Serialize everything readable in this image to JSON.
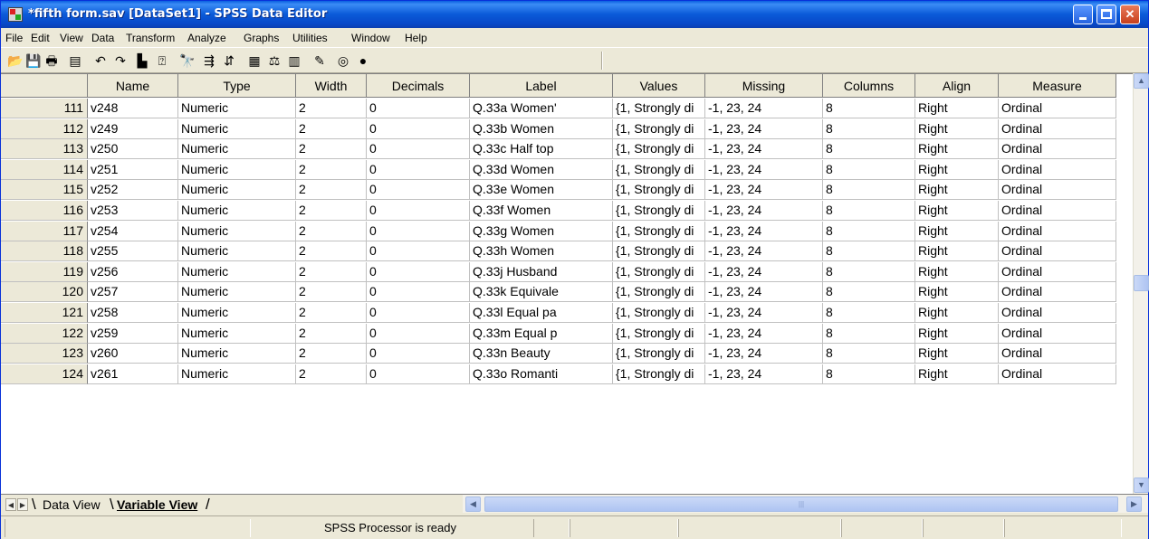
{
  "window": {
    "title": "*fifth form.sav [DataSet1] - SPSS Data Editor",
    "minimize": "",
    "maximize": "",
    "close": "✕"
  },
  "menu": [
    "File",
    "Edit",
    "View",
    "Data",
    "Transform",
    "Analyze",
    "Graphs",
    "Utilities",
    "Window",
    "Help"
  ],
  "toolbar_icons": [
    {
      "name": "open-icon",
      "glyph": "📂"
    },
    {
      "name": "save-icon",
      "glyph": "💾"
    },
    {
      "name": "print-icon",
      "glyph": "🖶"
    },
    {
      "name": "dialog-recall-icon",
      "glyph": "▤"
    },
    {
      "name": "undo-icon",
      "glyph": "↶"
    },
    {
      "name": "redo-icon",
      "glyph": "↷"
    },
    {
      "name": "goto-case-icon",
      "glyph": "▙"
    },
    {
      "name": "variables-icon",
      "glyph": "⍰"
    },
    {
      "name": "find-icon",
      "glyph": "🔭"
    },
    {
      "name": "insert-cases-icon",
      "glyph": "⇶"
    },
    {
      "name": "insert-variable-icon",
      "glyph": "⇵"
    },
    {
      "name": "split-file-icon",
      "glyph": "▦"
    },
    {
      "name": "weight-cases-icon",
      "glyph": "⚖"
    },
    {
      "name": "select-cases-icon",
      "glyph": "▥"
    },
    {
      "name": "value-labels-icon",
      "glyph": "✎"
    },
    {
      "name": "use-sets-icon",
      "glyph": "◎"
    },
    {
      "name": "show-all-icon",
      "glyph": "●"
    }
  ],
  "grid": {
    "columns": [
      "",
      "Name",
      "Type",
      "Width",
      "Decimals",
      "Label",
      "Values",
      "Missing",
      "Columns",
      "Align",
      "Measure"
    ],
    "rows": [
      {
        "num": "111",
        "cells": [
          "v248",
          "Numeric",
          "2",
          "0",
          "Q.33a Women'",
          "{1, Strongly di",
          "-1, 23, 24",
          "8",
          "Right",
          "Ordinal"
        ]
      },
      {
        "num": "112",
        "cells": [
          "v249",
          "Numeric",
          "2",
          "0",
          "Q.33b Women",
          "{1, Strongly di",
          "-1, 23, 24",
          "8",
          "Right",
          "Ordinal"
        ]
      },
      {
        "num": "113",
        "cells": [
          "v250",
          "Numeric",
          "2",
          "0",
          "Q.33c Half top",
          "{1, Strongly di",
          "-1, 23, 24",
          "8",
          "Right",
          "Ordinal"
        ]
      },
      {
        "num": "114",
        "cells": [
          "v251",
          "Numeric",
          "2",
          "0",
          "Q.33d Women",
          "{1, Strongly di",
          "-1, 23, 24",
          "8",
          "Right",
          "Ordinal"
        ]
      },
      {
        "num": "115",
        "cells": [
          "v252",
          "Numeric",
          "2",
          "0",
          "Q.33e Women",
          "{1, Strongly di",
          "-1, 23, 24",
          "8",
          "Right",
          "Ordinal"
        ]
      },
      {
        "num": "116",
        "cells": [
          "v253",
          "Numeric",
          "2",
          "0",
          "Q.33f Women",
          "{1, Strongly di",
          "-1, 23, 24",
          "8",
          "Right",
          "Ordinal"
        ]
      },
      {
        "num": "117",
        "cells": [
          "v254",
          "Numeric",
          "2",
          "0",
          "Q.33g Women",
          "{1, Strongly di",
          "-1, 23, 24",
          "8",
          "Right",
          "Ordinal"
        ]
      },
      {
        "num": "118",
        "cells": [
          "v255",
          "Numeric",
          "2",
          "0",
          "Q.33h Women",
          "{1, Strongly di",
          "-1, 23, 24",
          "8",
          "Right",
          "Ordinal"
        ]
      },
      {
        "num": "119",
        "cells": [
          "v256",
          "Numeric",
          "2",
          "0",
          "Q.33j Husband",
          "{1, Strongly di",
          "-1, 23, 24",
          "8",
          "Right",
          "Ordinal"
        ]
      },
      {
        "num": "120",
        "cells": [
          "v257",
          "Numeric",
          "2",
          "0",
          "Q.33k Equivale",
          "{1, Strongly di",
          "-1, 23, 24",
          "8",
          "Right",
          "Ordinal"
        ]
      },
      {
        "num": "121",
        "cells": [
          "v258",
          "Numeric",
          "2",
          "0",
          "Q.33l Equal pa",
          "{1, Strongly di",
          "-1, 23, 24",
          "8",
          "Right",
          "Ordinal"
        ]
      },
      {
        "num": "122",
        "cells": [
          "v259",
          "Numeric",
          "2",
          "0",
          "Q.33m Equal p",
          "{1, Strongly di",
          "-1, 23, 24",
          "8",
          "Right",
          "Ordinal"
        ]
      },
      {
        "num": "123",
        "cells": [
          "v260",
          "Numeric",
          "2",
          "0",
          "Q.33n Beauty",
          "{1, Strongly di",
          "-1, 23, 24",
          "8",
          "Right",
          "Ordinal"
        ]
      },
      {
        "num": "124",
        "cells": [
          "v261",
          "Numeric",
          "2",
          "0",
          "Q.33o Romanti",
          "{1, Strongly di",
          "-1, 23, 24",
          "8",
          "Right",
          "Ordinal"
        ]
      }
    ]
  },
  "tabs": {
    "data_view": "Data View",
    "variable_view": "Variable View"
  },
  "status": {
    "text": "SPSS Processor is ready"
  }
}
